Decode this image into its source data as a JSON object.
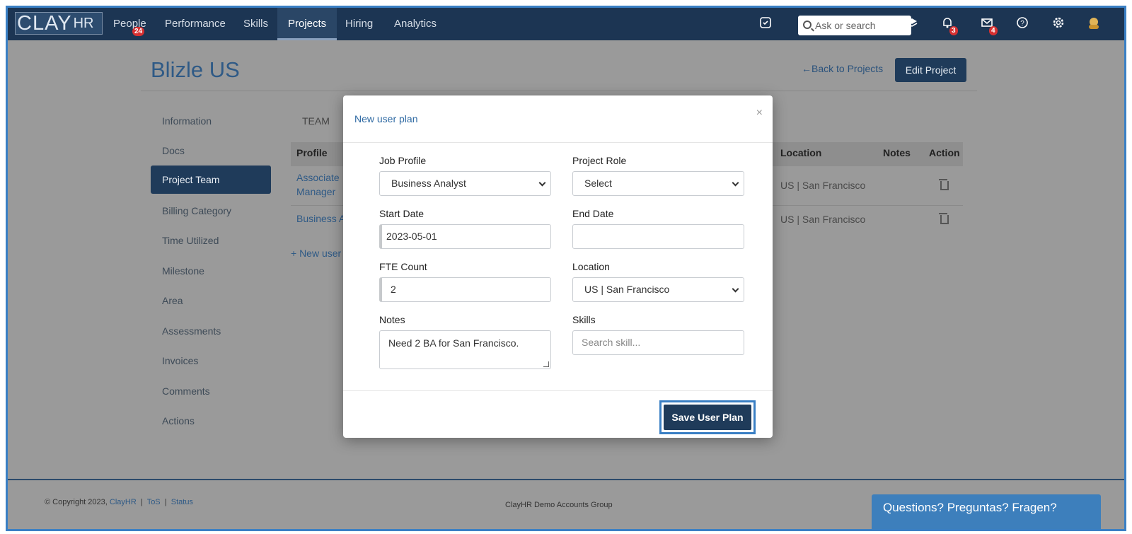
{
  "app": {
    "logo_main": "CLAY",
    "logo_sub": "HR"
  },
  "nav": {
    "items": [
      {
        "label": "People",
        "badge": "24"
      },
      {
        "label": "Performance"
      },
      {
        "label": "Skills"
      },
      {
        "label": "Projects"
      },
      {
        "label": "Hiring"
      },
      {
        "label": "Analytics"
      }
    ],
    "search_placeholder": "Ask or search",
    "notif_badge": "3",
    "mail_badge": "4"
  },
  "page": {
    "title": "Blizle US",
    "back_link": "←Back to Projects",
    "edit_button": "Edit Project",
    "sidebar": [
      "Information",
      "Docs",
      "Project Team",
      "Billing Category",
      "Time Utilized",
      "Milestone",
      "Area",
      "Assessments",
      "Invoices",
      "Comments",
      "Actions"
    ],
    "team_tab": "TEAM",
    "table_headers": {
      "profile": "Profile",
      "location": "Location",
      "notes": "Notes",
      "action": "Action"
    },
    "rows": [
      {
        "profile_l1": "Associate",
        "profile_l2": "Manager",
        "location": "US | San Francisco"
      },
      {
        "profile_l1": "Business A",
        "location": "US | San Francisco"
      }
    ],
    "new_user_link": "+ New user"
  },
  "modal": {
    "title": "New user plan",
    "close": "×",
    "job_profile_label": "Job Profile",
    "job_profile_value": "Business Analyst",
    "project_role_label": "Project Role",
    "project_role_value": "Select",
    "start_date_label": "Start Date",
    "start_date_value": "2023-05-01",
    "end_date_label": "End Date",
    "end_date_value": "",
    "fte_label": "FTE Count",
    "fte_value": "2",
    "location_label": "Location",
    "location_value": "US | San Francisco",
    "notes_label": "Notes",
    "notes_value": "Need 2 BA for San Francisco.",
    "skills_label": "Skills",
    "skills_placeholder": "Search skill...",
    "save_button": "Save User Plan"
  },
  "footer": {
    "copyright": "© Copyright 2023,",
    "company_link": "ClayHR",
    "tos": "ToS",
    "status": "Status",
    "group": "ClayHR Demo Accounts Group",
    "chat": "Questions? Preguntas? Fragen?"
  }
}
